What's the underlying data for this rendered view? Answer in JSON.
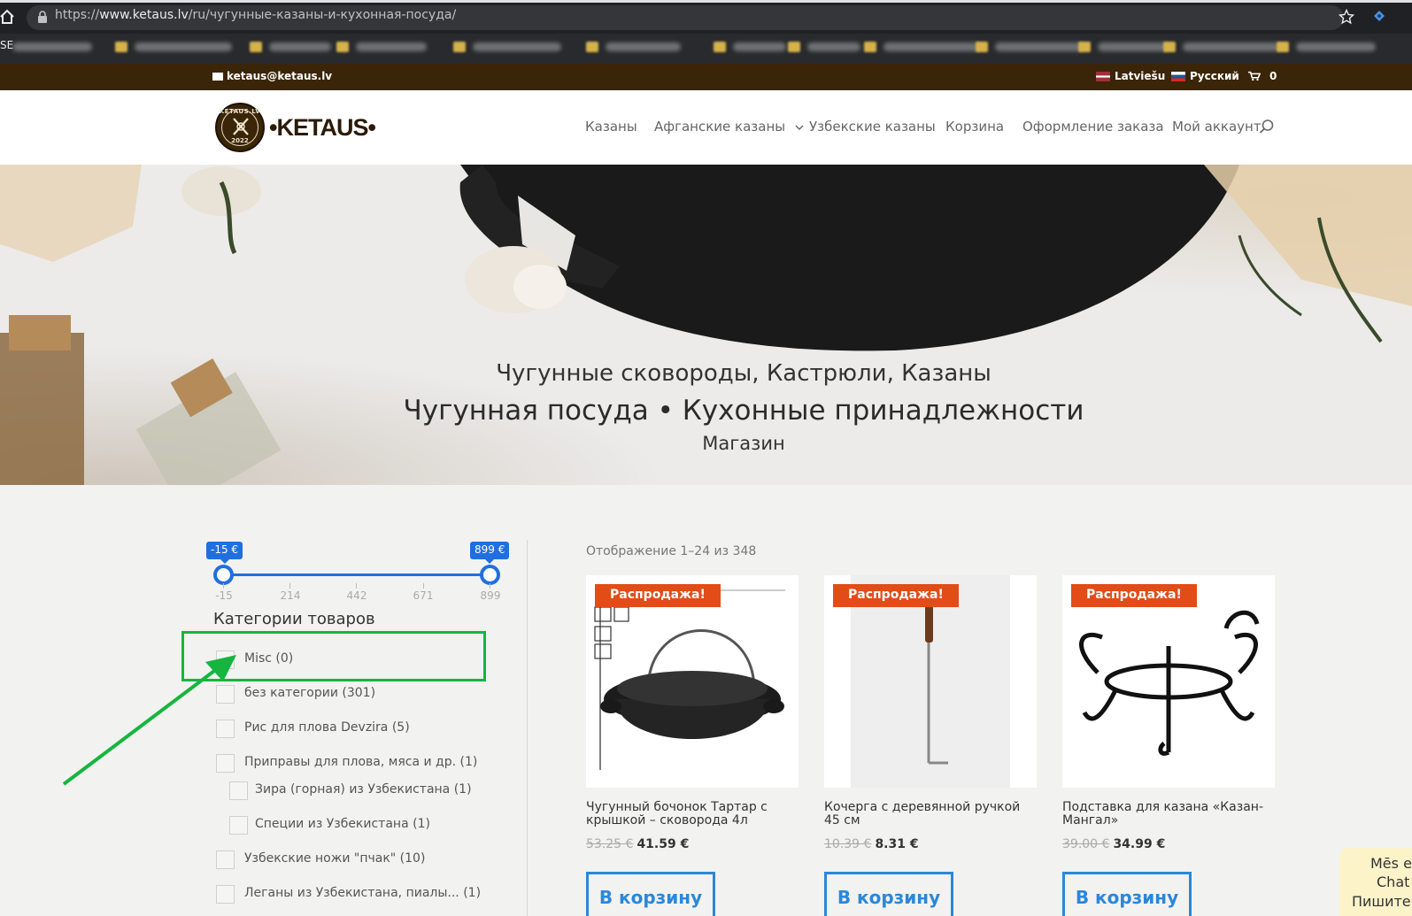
{
  "browser": {
    "url_prefix": "https://",
    "url_host": "www.ketaus.lv",
    "url_path": "/ru/чугунные-казаны-и-кухонная-посуда/",
    "bookmarks_label": "SE"
  },
  "topbar": {
    "email": "ketaus@ketaus.lv",
    "lang_lv": "Latviešu",
    "lang_ru": "Русский",
    "cart_count": "0"
  },
  "header": {
    "logo_word": "•KETAUS•",
    "logo_ring_text": "KETAUS.LV",
    "logo_year": "2022",
    "nav": [
      "Казаны",
      "Афганские казаны",
      "Узбекские казаны",
      "Корзина",
      "Оформление заказа",
      "Мой аккаунт"
    ]
  },
  "hero": {
    "line1": "Чугунные сковороды, Кастрюли, Казаны",
    "line2": "Чугунная посуда • Кухонные принадлежности",
    "line3": "Магазин"
  },
  "filter": {
    "price_min_label": "-15 €",
    "price_max_label": "899 €",
    "ticks": [
      "-15",
      "214",
      "442",
      "671",
      "899"
    ],
    "categories_heading": "Категории товаров",
    "categories": [
      "Misc (0)",
      "без категории (301)",
      "Рис для плова Devzira (5)",
      "Приправы для плова, мяса и др. (1)",
      "Зира (горная) из Узбекистана (1)",
      "Специи из Узбекистана (1)",
      "Узбекские ножи \"пчак\" (10)",
      "Леганы из Узбекистана, пиалы... (1)"
    ]
  },
  "products": {
    "showing": "Отображение 1–24 из 348",
    "sale_label": "Распродажа!",
    "button_label": "В корзину",
    "items": [
      {
        "title": "Чугунный бочонок Тартар с крышкой – сковорода 4л",
        "old_price": "53.25 €",
        "price": "41.59 €"
      },
      {
        "title": "Кочерга с деревянной ручкой 45 см",
        "old_price": "10.39 €",
        "price": "8.31 €"
      },
      {
        "title": "Подставка для казана «Казан-Мангал»",
        "old_price": "39.00 €",
        "price": "34.99 €"
      }
    ]
  },
  "chat": {
    "line1": "Mēs e",
    "line2": "Chat",
    "line3": "Пишите."
  },
  "colors": {
    "topbar_bg": "#3a2508",
    "sale_badge": "#e24c17",
    "button_blue": "#2b87da",
    "slider_blue": "#1f6fe0",
    "highlight_green": "#16b53f"
  }
}
